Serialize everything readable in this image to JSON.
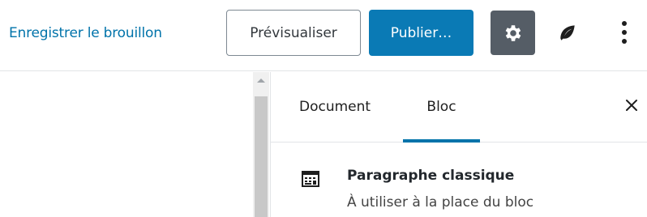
{
  "toolbar": {
    "save_draft_label": "Enregistrer le brouillon",
    "preview_label": "Prévisualiser",
    "publish_label": "Publier…",
    "settings_icon": "gear-icon",
    "plugin_icon": "leaf-icon",
    "more_icon": "vertical-ellipsis-icon"
  },
  "sidebar": {
    "tabs": [
      {
        "label": "Document",
        "active": false
      },
      {
        "label": "Bloc",
        "active": true
      }
    ],
    "close_icon": "close-icon",
    "block": {
      "icon": "classic-editor-icon",
      "title": "Paragraphe classique",
      "description": "À utiliser à la place du bloc"
    }
  },
  "colors": {
    "accent": "#0073aa",
    "publish_bg": "#0a7ab5",
    "settings_bg": "#555d66"
  }
}
